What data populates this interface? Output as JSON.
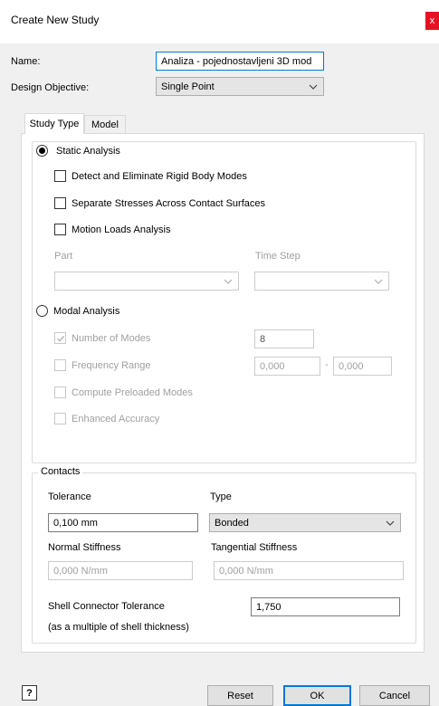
{
  "window": {
    "title": "Create New Study",
    "close_label": "x"
  },
  "form": {
    "name_label": "Name:",
    "name_value": "Analiza - pojednostavljeni 3D mod",
    "objective_label": "Design Objective:",
    "objective_value": "Single Point"
  },
  "tabs": [
    {
      "label": "Study Type",
      "active": true
    },
    {
      "label": "Model",
      "active": false
    }
  ],
  "static": {
    "label": "Static Analysis",
    "selected": true,
    "options": [
      {
        "label": "Detect and Eliminate Rigid Body Modes",
        "checked": false
      },
      {
        "label": "Separate Stresses Across Contact Surfaces",
        "checked": false
      },
      {
        "label": "Motion Loads Analysis",
        "checked": false
      }
    ],
    "part_label": "Part",
    "time_step_label": "Time Step"
  },
  "modal": {
    "label": "Modal Analysis",
    "selected": false,
    "number_of_modes_label": "Number of Modes",
    "number_of_modes_value": "8",
    "frequency_range_label": "Frequency Range",
    "freq_from": "0,000",
    "freq_sep": "-",
    "freq_to": "0,000",
    "compute_preloaded_label": "Compute Preloaded Modes",
    "enhanced_accuracy_label": "Enhanced Accuracy"
  },
  "contacts": {
    "legend": "Contacts",
    "tolerance_label": "Tolerance",
    "tolerance_value": "0,100 mm",
    "type_label": "Type",
    "type_value": "Bonded",
    "normal_stiffness_label": "Normal Stiffness",
    "normal_stiffness_value": "0,000 N/mm",
    "tangential_stiffness_label": "Tangential Stiffness",
    "tangential_stiffness_value": "0,000 N/mm",
    "shell_tolerance_label": "Shell Connector Tolerance",
    "shell_tolerance_value": "1,750",
    "shell_note": "(as a multiple of shell thickness)"
  },
  "buttons": {
    "help": "?",
    "reset": "Reset",
    "ok": "OK",
    "cancel": "Cancel"
  },
  "icons": [
    "close-icon",
    "chevron-down-icon",
    "checkmark-icon",
    "help-icon"
  ]
}
